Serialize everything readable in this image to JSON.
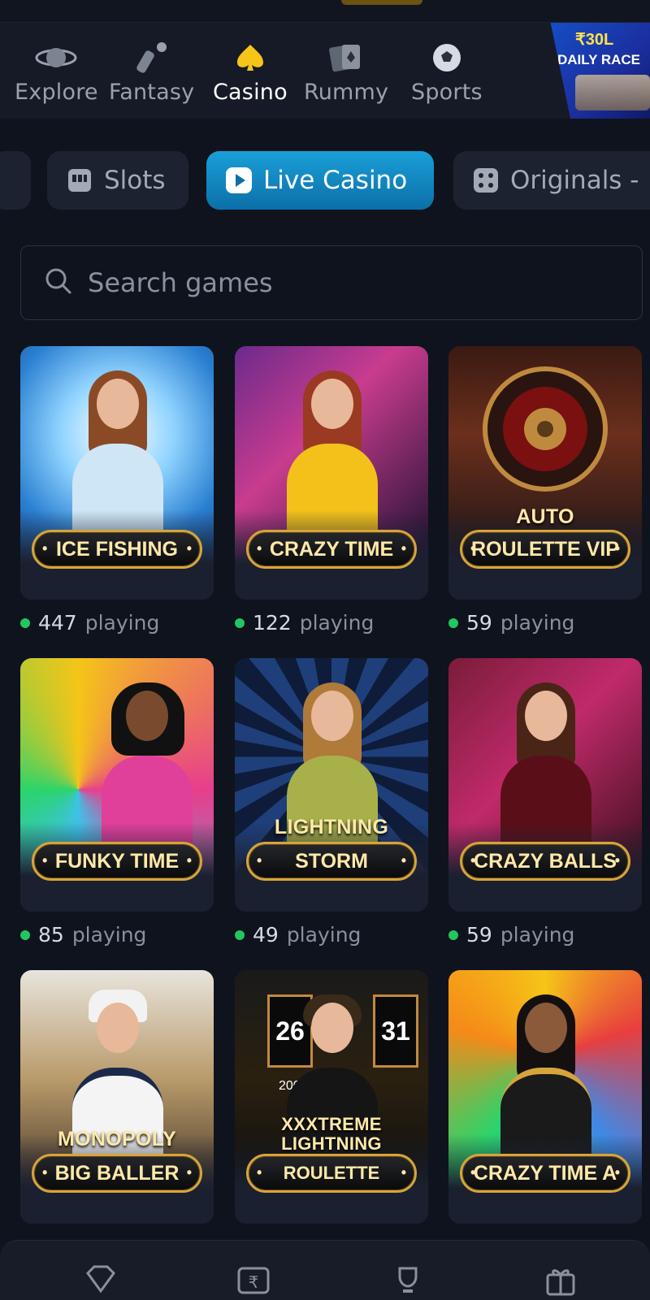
{
  "category_nav": {
    "items": [
      {
        "label": "Explore",
        "icon": "planet-icon",
        "active": false
      },
      {
        "label": "Fantasy",
        "icon": "cricket-bat-icon",
        "active": false
      },
      {
        "label": "Casino",
        "icon": "spade-icon",
        "active": true
      },
      {
        "label": "Rummy",
        "icon": "cards-icon",
        "active": false
      },
      {
        "label": "Sports",
        "icon": "football-icon",
        "active": false
      }
    ],
    "banner": {
      "amount": "₹30L",
      "label": "DAILY RACE"
    }
  },
  "filter_chips": [
    {
      "label": "Slots",
      "icon": "slot-machine-icon",
      "active": false
    },
    {
      "label": "Live Casino",
      "icon": "play-icon",
      "active": true
    },
    {
      "label": "Originals -",
      "icon": "dice-icon",
      "active": false
    }
  ],
  "search": {
    "placeholder": "Search games"
  },
  "games": [
    {
      "over": "",
      "plate": "ICE FISHING",
      "count": "447",
      "word": "playing"
    },
    {
      "over": "",
      "plate": "CRAZY TIME",
      "count": "122",
      "word": "playing"
    },
    {
      "over": "AUTO",
      "plate": "ROULETTE VIP",
      "count": "59",
      "word": "playing"
    },
    {
      "over": "",
      "plate": "FUNKY TIME",
      "count": "85",
      "word": "playing"
    },
    {
      "over": "LIGHTNING",
      "plate": "STORM",
      "count": "49",
      "word": "playing"
    },
    {
      "over": "",
      "plate": "CRAZY BALLS",
      "count": "59",
      "word": "playing"
    },
    {
      "over": "MONOPOLY",
      "plate": "BIG BALLER",
      "count": "",
      "word": ""
    },
    {
      "over": "XXXTREME LIGHTNING",
      "plate": "ROULETTE",
      "count": "",
      "word": "",
      "scores": [
        "26",
        "31",
        "200"
      ]
    },
    {
      "over": "",
      "plate": "CRAZY TIME A",
      "count": "",
      "word": ""
    }
  ],
  "bottom_nav": [
    {
      "icon": "diamond-icon"
    },
    {
      "icon": "rupee-card-icon"
    },
    {
      "icon": "trophy-icon"
    },
    {
      "icon": "gift-icon"
    }
  ],
  "colors": {
    "accent": "#1a9fd8",
    "gold": "#d6a43a",
    "online": "#22c55e",
    "background": "#0f131d"
  }
}
